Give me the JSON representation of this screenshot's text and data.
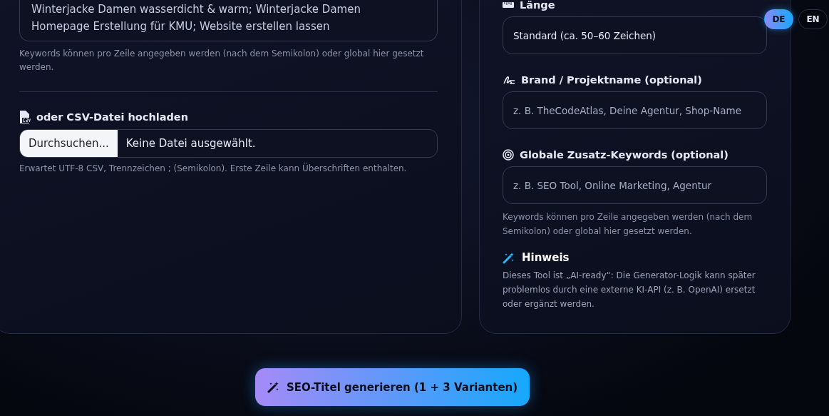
{
  "language_switch": [
    {
      "label": "DE",
      "selected": true
    },
    {
      "label": "EN",
      "selected": false
    }
  ],
  "input_card": {
    "textarea_lines": [
      "Winterjacke Damen wasserdicht & warm; Winterjacke Damen",
      "Homepage Erstellung für KMU; Website erstellen lassen"
    ],
    "textarea_hint": "Keywords können pro Zeile angegeben werden (nach dem Semikolon) oder global hier gesetzt werden.",
    "csv_label": "oder CSV-Datei hochladen",
    "file_button": "Durchsuchen...",
    "file_status": "Keine Datei ausgewählt.",
    "csv_hint": "Erwartet UTF-8 CSV, Trennzeichen ; (Semikolon). Erste Zeile kann Überschriften enthalten."
  },
  "settings_card": {
    "fields": [
      {
        "kind": "select",
        "label": "Länge",
        "value": "Standard (ca. 50–60 Zeichen)"
      },
      {
        "kind": "text",
        "label": "Brand / Projektname (optional)",
        "placeholder": "z. B. TheCodeAtlas, Deine Agentur, Shop-Name"
      },
      {
        "kind": "text",
        "label": "Globale Zusatz-Keywords (optional)",
        "placeholder": "z. B. SEO Tool, Online Marketing, Agentur",
        "hint": "Keywords können pro Zeile angegeben werden (nach dem Semikolon) oder global hier gesetzt werden."
      }
    ],
    "note_title": "Hinweis",
    "note_text": "Dieses Tool ist „AI-ready“: Die Generator-Logik kann später problemlos durch eine externe KI-API (z. B. OpenAI) ersetzt oder ergänzt werden."
  },
  "generate_button": "SEO-Titel generieren (1 + 3 Varianten)"
}
